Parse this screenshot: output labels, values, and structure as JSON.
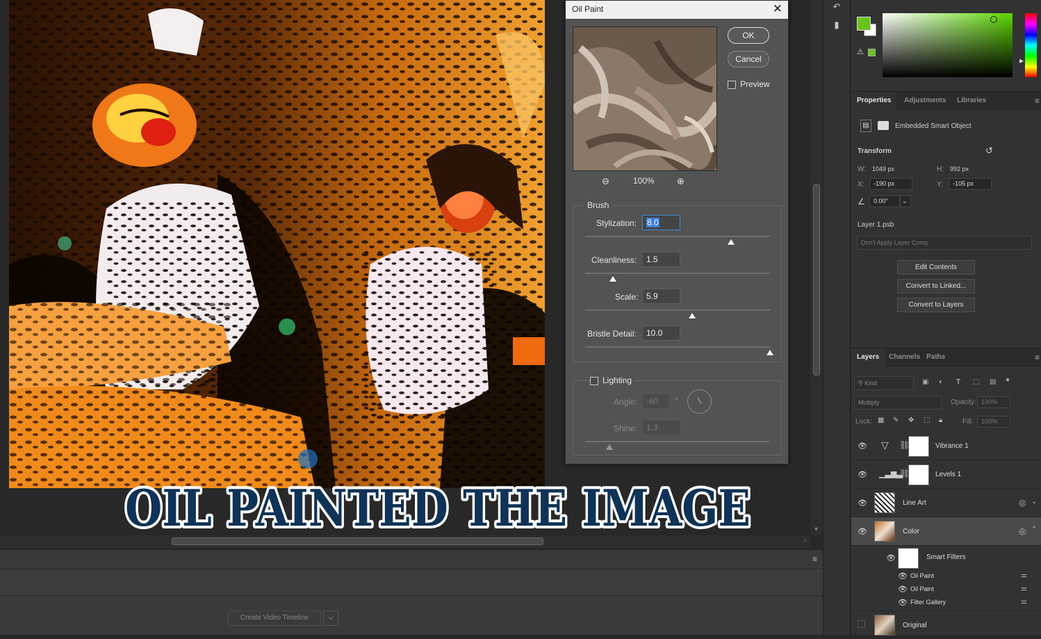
{
  "headline": "OIL PAINTED THE IMAGE",
  "dialog": {
    "title": "Oil Paint",
    "ok": "OK",
    "cancel": "Cancel",
    "preview_label": "Preview",
    "zoom": "100%",
    "brush": {
      "caption": "Brush",
      "stylization_label": "Stylization:",
      "stylization_value": "8.0",
      "stylization_level": 0.79,
      "cleanliness_label": "Cleanliness:",
      "cleanliness_value": "1.5",
      "cleanliness_level": 0.15,
      "scale_label": "Scale:",
      "scale_value": "5.9",
      "scale_level": 0.58,
      "bristle_label": "Bristle Detail:",
      "bristle_value": "10.0",
      "bristle_level": 1.0
    },
    "lighting": {
      "caption": "Lighting",
      "angle_label": "Angle:",
      "angle_value": "-60",
      "degree": "°",
      "shine_label": "Shine:",
      "shine_value": "1.3",
      "shine_level": 0.13
    }
  },
  "timeline": {
    "create_button": "Create Video Timeline"
  },
  "color_panel": {
    "foreground": "#68c31c",
    "background": "#ffffff"
  },
  "properties": {
    "tabs": [
      "Properties",
      "Adjustments",
      "Libraries"
    ],
    "object_type": "Embedded Smart Object",
    "transform_label": "Transform",
    "w_label": "W:",
    "w_value": "1049 px",
    "h_label": "H:",
    "h_value": "992 px",
    "x_label": "X:",
    "x_value": "-190 px",
    "y_label": "Y:",
    "y_value": "-105 px",
    "angle_value": "0.00°",
    "file_name": "Layer 1.psb",
    "layer_comp": "Don't Apply Layer Comp",
    "edit_contents": "Edit Contents",
    "convert_linked": "Convert to Linked...",
    "convert_layers": "Convert to Layers"
  },
  "layers_panel": {
    "tabs": [
      "Layers",
      "Channels",
      "Paths"
    ],
    "kind": "Kind",
    "blend_mode": "Multiply",
    "opacity_label": "Opacity:",
    "opacity_value": "100%",
    "lock_label": "Lock:",
    "fill_label": "Fill:",
    "fill_value": "100%",
    "layers": [
      "Vibrance 1",
      "Levels 1",
      "Line Art",
      "Color"
    ],
    "smart_filters_label": "Smart Filters",
    "filters": [
      "Oil Paint",
      "Oil Paint",
      "Filter Gallery"
    ],
    "bottom_layer": "Original"
  }
}
